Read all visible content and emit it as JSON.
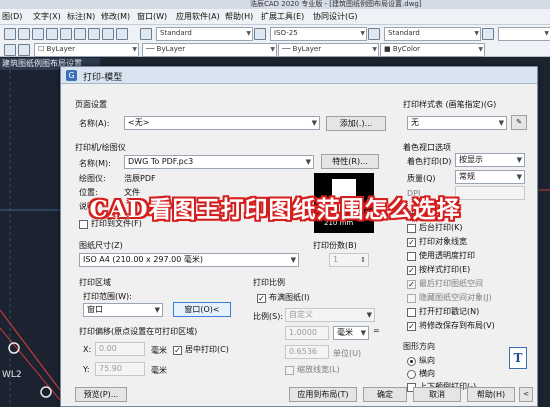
{
  "app": {
    "title": "浩辰CAD 2020 专业版 - [建筑图纸例图布局设置.dwg]",
    "menu": [
      "图(D)",
      "文字(X)",
      "标注(N)",
      "修改(M)",
      "窗口(W)",
      "应用软件(A)",
      "帮助(H)",
      "扩展工具(E)",
      "协同设计(G)"
    ],
    "toolbar": {
      "text_style": "Standard",
      "dim_style": "ISO-25",
      "table_style": "Standard",
      "layer": "ByLayer",
      "linetype": "ByLayer",
      "lineweight": "ByLayer",
      "color": "ByColor"
    },
    "doc_tab": "建筑图纸例图布局设置",
    "canvas_label": "WL2"
  },
  "dialog": {
    "title": "打印-模型",
    "page_setup": {
      "section": "页面设置",
      "name_label": "名称(A):",
      "name_value": "<无>",
      "add_button": "添加(.)..."
    },
    "plotter": {
      "section": "打印机/绘图仪",
      "name_label": "名称(M):",
      "name_value": "DWG To PDF.pc3",
      "properties_button": "特性(R)...",
      "plotter_label": "绘图仪:",
      "plotter_value": "浩辰PDF",
      "location_label": "位置:",
      "location_value": "文件",
      "desc_label": "说明:",
      "plot_to_file": "打印到文件(F)",
      "preview_dim": "210 mm"
    },
    "paper_size": {
      "section": "图纸尺寸(Z)",
      "value": "ISO A4 (210.00 x 297.00 毫米)"
    },
    "copies": {
      "label": "打印份数(B)",
      "value": "1"
    },
    "plot_area": {
      "section": "打印区域",
      "range_label": "打印范围(W):",
      "range_value": "窗口",
      "window_button": "窗口(O)<"
    },
    "plot_offset": {
      "section": "打印偏移(原点设置在可打印区域)",
      "x_label": "X:",
      "x_value": "0.00",
      "y_label": "Y:",
      "y_value": "75.90",
      "unit": "毫米",
      "center_plot": "居中打印(C)"
    },
    "plot_scale": {
      "section": "打印比例",
      "fit_paper": "布满图纸(I)",
      "scale_label": "比例(S):",
      "scale_value": "自定义",
      "value1": "1.0000",
      "unit1": "毫米",
      "eq": "=",
      "value2": "0.6536",
      "unit2": "单位(U)",
      "scale_lineweights": "缩放线宽(L)"
    },
    "plot_style_table": {
      "section": "打印样式表 (画笔指定)(G)",
      "value": "无"
    },
    "shaded_viewport": {
      "section": "着色视口选项",
      "shade_label": "着色打印(D)",
      "shade_value": "按显示",
      "quality_label": "质量(Q)",
      "quality_value": "常规",
      "dpi_label": "DPI"
    },
    "plot_options": {
      "section": "打印选项",
      "items": [
        {
          "label": "后台打印(K)",
          "checked": false
        },
        {
          "label": "打印对象线宽",
          "checked": true
        },
        {
          "label": "使用透明度打印",
          "checked": false
        },
        {
          "label": "按样式打印(E)",
          "checked": true
        },
        {
          "label": "最后打印图纸空间",
          "checked": true
        },
        {
          "label": "隐藏图纸空间对象(J)",
          "checked": false
        },
        {
          "label": "打开打印戳记(N)",
          "checked": false
        },
        {
          "label": "将修改保存到布局(V)",
          "checked": true
        }
      ]
    },
    "orientation": {
      "section": "图形方向",
      "portrait": "纵向",
      "landscape": "横向",
      "upside_down": "上下颠倒打印(-)"
    },
    "buttons": {
      "preview": "预览(P)...",
      "apply_layout": "应用到布局(T)",
      "ok": "确定",
      "cancel": "取消",
      "help": "帮助(H)"
    }
  },
  "overlay": {
    "title": "CAD看图王打印图纸范围怎么选择"
  }
}
